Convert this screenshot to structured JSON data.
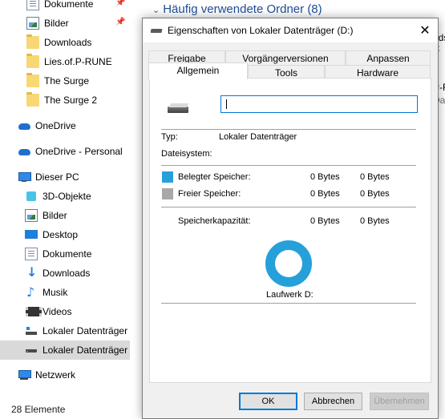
{
  "explorer": {
    "nav_items": [
      {
        "label": "Dokumente",
        "icon": "documents-icon",
        "pinned": true
      },
      {
        "label": "Bilder",
        "icon": "pictures-icon",
        "pinned": true
      },
      {
        "label": "Downloads",
        "icon": "folder-icon"
      },
      {
        "label": "Lies.of.P-RUNE",
        "icon": "folder-icon"
      },
      {
        "label": "The Surge",
        "icon": "folder-icon"
      },
      {
        "label": "The Surge 2",
        "icon": "folder-icon"
      },
      {
        "label": "OneDrive",
        "icon": "onedrive-icon"
      },
      {
        "label": "OneDrive - Personal",
        "icon": "onedrive-icon"
      },
      {
        "label": "Dieser PC",
        "icon": "this-pc-icon"
      },
      {
        "label": "3D-Objekte",
        "icon": "3d-objects-icon"
      },
      {
        "label": "Bilder",
        "icon": "pictures-icon"
      },
      {
        "label": "Desktop",
        "icon": "desktop-icon"
      },
      {
        "label": "Dokumente",
        "icon": "documents-icon"
      },
      {
        "label": "Downloads",
        "icon": "downloads-icon"
      },
      {
        "label": "Musik",
        "icon": "music-icon"
      },
      {
        "label": "Videos",
        "icon": "videos-icon"
      },
      {
        "label": "Lokaler Datenträger (",
        "icon": "system-drive-icon"
      },
      {
        "label": "Lokaler Datenträger (",
        "icon": "drive-icon",
        "selected": true
      },
      {
        "label": "Netzwerk",
        "icon": "network-icon"
      }
    ],
    "status": "28 Elemente",
    "section_header": "Häufig verwendete Ordner (8)",
    "right_peek": [
      "ads",
      "C",
      "P-R",
      "Dat"
    ]
  },
  "dialog": {
    "title": "Eigenschaften von Lokaler Datenträger (D:)",
    "close_glyph": "✕",
    "tabs_row1": [
      "Freigabe",
      "Vorgängerversionen",
      "Anpassen"
    ],
    "tabs_row2": [
      "Allgemein",
      "Tools",
      "Hardware"
    ],
    "active_tab": "Allgemein",
    "name_value": "",
    "type_label": "Typ:",
    "type_value": "Lokaler Datenträger",
    "fs_label": "Dateisystem:",
    "fs_value": "",
    "used_label": "Belegter Speicher:",
    "used_bytes": "0 Bytes",
    "used_human": "0 Bytes",
    "free_label": "Freier Speicher:",
    "free_bytes": "0 Bytes",
    "free_human": "0 Bytes",
    "capacity_label": "Speicherkapazität:",
    "capacity_bytes": "0 Bytes",
    "capacity_human": "0 Bytes",
    "drive_label": "Laufwerk D:",
    "used_color": "#26a0da",
    "free_color": "#a8a8a8",
    "buttons": {
      "ok": "OK",
      "cancel": "Abbrechen",
      "apply": "Übernehmen"
    }
  }
}
